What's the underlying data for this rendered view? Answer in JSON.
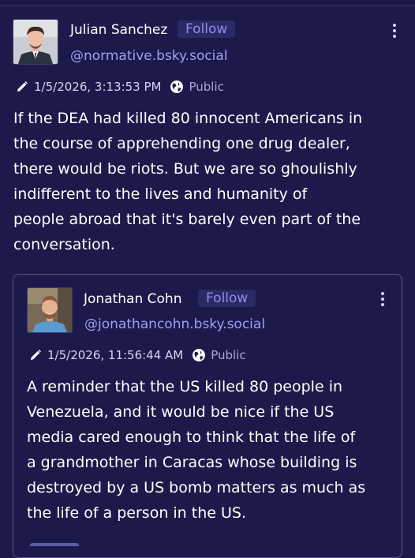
{
  "post": {
    "author_name": "Julian Sanchez",
    "follow_label": "Follow",
    "handle": "@normative.bsky.social",
    "timestamp": "1/5/2026, 3:13:53 PM",
    "visibility": "Public",
    "text": "If the DEA had killed 80 innocent Americans in\nthe course of apprehending one drug dealer,\nthere would be riots. But we are so ghoulishly\nindifferent to the lives and humanity of\npeople abroad that it's barely even part of the\nconversation."
  },
  "quoted_post": {
    "author_name": "Jonathan Cohn",
    "follow_label": "Follow",
    "handle": "@jonathancohn.bsky.social",
    "timestamp": "1/5/2026, 11:56:44 AM",
    "visibility": "Public",
    "text": "A reminder that the US killed 80 people in\nVenezuela, and it would be nice if the US\nmedia cared enough to think that the life of\na grandmother in Caracas whose building is\ndestroyed by a US bomb matters as much as\nthe life of a person in the US."
  },
  "icons": {
    "edit": "pencil-icon",
    "visibility": "globe-icon",
    "menu": "more-vertical-icon"
  },
  "colors": {
    "background": "#1c1a4a",
    "accent": "#8f8cf0",
    "handle": "#a29ff5"
  }
}
